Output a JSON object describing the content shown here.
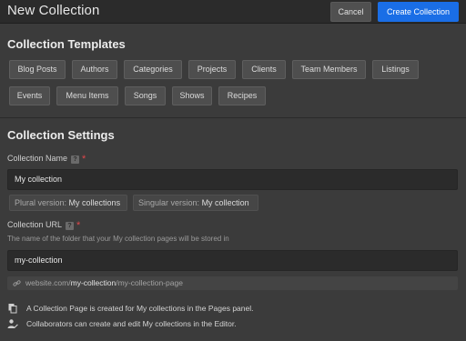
{
  "header": {
    "title": "New Collection",
    "cancel_label": "Cancel",
    "create_label": "Create Collection"
  },
  "templates": {
    "title": "Collection Templates",
    "items": [
      "Blog Posts",
      "Authors",
      "Categories",
      "Projects",
      "Clients",
      "Team Members",
      "Listings",
      "Events",
      "Menu Items",
      "Songs",
      "Shows",
      "Recipes"
    ]
  },
  "settings": {
    "title": "Collection Settings",
    "name_label": "Collection Name",
    "help_badge": "?",
    "required_mark": "*",
    "name_value": "My collection",
    "plural_prefix": "Plural version:",
    "plural_value": "My collections",
    "singular_prefix": "Singular version:",
    "singular_value": "My collection",
    "url_label": "Collection URL",
    "url_hint": "The name of the folder that your My collection pages will be stored in",
    "url_value": "my-collection",
    "preview": {
      "domain": "website.com/",
      "slug": "my-collection",
      "rest": "/my-collection-page"
    },
    "info_pages": "A Collection Page is created for My collections in the Pages panel.",
    "info_editor": "Collaborators can create and edit My collections in the Editor."
  },
  "colors": {
    "accent": "#1a6ee6",
    "required": "#e0474b",
    "background": "#3b3b3b"
  },
  "icons": {
    "url": "link-icon",
    "pages": "pages-icon",
    "editor": "collaborator-icon"
  }
}
